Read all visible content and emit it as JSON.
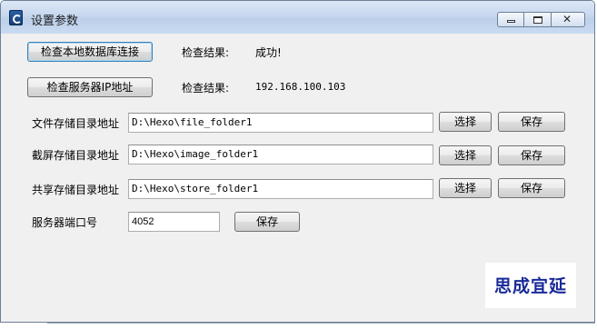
{
  "window": {
    "title": "设置参数",
    "controls": {
      "minimize": "minimize",
      "maximize": "maximize",
      "close": "✕"
    }
  },
  "db_check": {
    "button": "检查本地数据库连接",
    "result_label": "检查结果:",
    "result_value": "成功!"
  },
  "server_check": {
    "button": "检查服务器IP地址",
    "result_label": "检查结果:",
    "result_value": "192.168.100.103"
  },
  "file_storage": {
    "label": "文件存储目录地址",
    "value": "D:\\Hexo\\file_folder1",
    "select_button": "选择",
    "save_button": "保存"
  },
  "screenshot_storage": {
    "label": "截屏存储目录地址",
    "value": "D:\\Hexo\\image_folder1",
    "select_button": "选择",
    "save_button": "保存"
  },
  "shared_storage": {
    "label": "共享存储目录地址",
    "value": "D:\\Hexo\\store_folder1",
    "select_button": "选择",
    "save_button": "保存"
  },
  "server_port": {
    "label": "服务器端口号",
    "value": "4052",
    "save_button": "保存"
  },
  "logo": {
    "text": "思成宜延",
    "color": "#1a2a9a"
  }
}
